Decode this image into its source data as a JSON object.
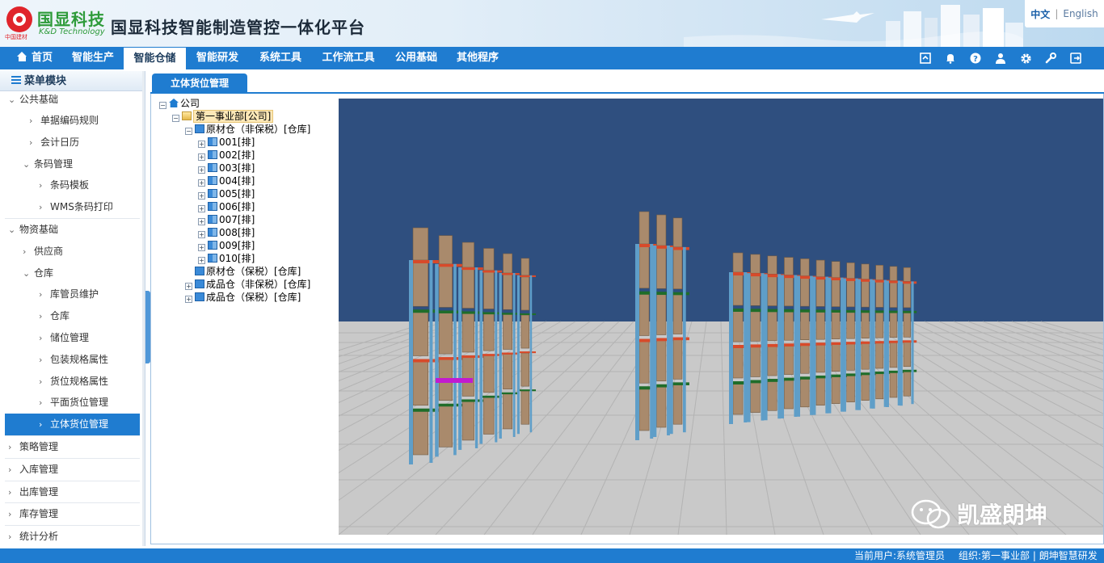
{
  "header": {
    "logo_cn": "国显科技",
    "logo_en": "K&D Technology",
    "logo_sub": "中国建材",
    "title": "国显科技智能制造管控一体化平台",
    "lang_current": "中文",
    "lang_separator": "|",
    "lang_other": "English"
  },
  "nav": {
    "items": [
      "首页",
      "智能生产",
      "智能仓储",
      "智能研发",
      "系统工具",
      "工作流工具",
      "公用基础",
      "其他程序"
    ],
    "active_index": 2,
    "tools": [
      "refresh-icon",
      "bell-icon",
      "help-icon",
      "user-icon",
      "gear-icon",
      "wrench-icon",
      "logout-icon"
    ]
  },
  "sidebar": {
    "title": "菜单模块",
    "rows": [
      {
        "label": "公共基础",
        "level": 0,
        "chevron": "⌄"
      },
      {
        "label": "单据编码规则",
        "level": 2,
        "chevron": "›"
      },
      {
        "label": "会计日历",
        "level": 2,
        "chevron": "›"
      },
      {
        "label": "条码管理",
        "level": 1,
        "chevron": "⌄"
      },
      {
        "label": "条码模板",
        "level": 3,
        "chevron": "›"
      },
      {
        "label": "WMS条码打印",
        "level": 3,
        "chevron": "›"
      },
      {
        "label": "物资基础",
        "level": 0,
        "chevron": "⌄"
      },
      {
        "label": "供应商",
        "level": 1,
        "chevron": "›"
      },
      {
        "label": "仓库",
        "level": 1,
        "chevron": "⌄"
      },
      {
        "label": "库管员维护",
        "level": 3,
        "chevron": "›"
      },
      {
        "label": "仓库",
        "level": 3,
        "chevron": "›"
      },
      {
        "label": "储位管理",
        "level": 3,
        "chevron": "›"
      },
      {
        "label": "包装规格属性",
        "level": 3,
        "chevron": "›"
      },
      {
        "label": "货位规格属性",
        "level": 3,
        "chevron": "›"
      },
      {
        "label": "平面货位管理",
        "level": 3,
        "chevron": "›"
      },
      {
        "label": "立体货位管理",
        "level": 3,
        "chevron": "›",
        "selected": true
      },
      {
        "label": "策略管理",
        "level": 0,
        "chevron": "›"
      },
      {
        "label": "入库管理",
        "level": 0,
        "chevron": "›"
      },
      {
        "label": "出库管理",
        "level": 0,
        "chevron": "›"
      },
      {
        "label": "库存管理",
        "level": 0,
        "chevron": "›"
      },
      {
        "label": "统计分析",
        "level": 0,
        "chevron": "›"
      }
    ]
  },
  "tab": {
    "label": "立体货位管理"
  },
  "tree": {
    "root": "公司",
    "org": "第一事业部[公司]",
    "warehouse_open": "原材仓（非保税）[仓库]",
    "rows": [
      "001[排]",
      "002[排]",
      "003[排]",
      "004[排]",
      "005[排]",
      "006[排]",
      "007[排]",
      "008[排]",
      "009[排]",
      "010[排]"
    ],
    "warehouses_closed": [
      "原材仓（保税）[仓库]",
      "成品仓（非保税）[仓库]",
      "成品仓（保税）[仓库]"
    ]
  },
  "scene": {
    "sky_color": "#2f4f7f",
    "floor_color": "#c9c9c9",
    "rack_post_color": "#5f9ec8",
    "beam_colors": [
      "#d84a2a",
      "#1f6d2a",
      "#ffffff"
    ],
    "box_color": "#a98a6c"
  },
  "watermark": {
    "text": "凯盛朗坤"
  },
  "status": {
    "user": "当前用户:系统管理员",
    "org": "组织:第一事业部 | 朗坤智慧研发"
  }
}
